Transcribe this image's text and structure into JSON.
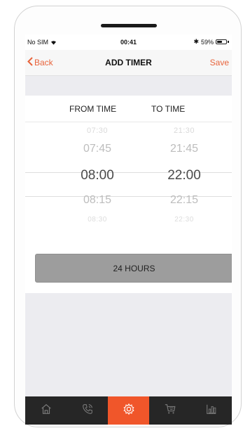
{
  "status_bar": {
    "carrier": "No SIM",
    "wifi_icon": "wifi-icon",
    "time": "00:41",
    "bluetooth": "✱",
    "battery_percent": "59%",
    "battery_level": 0.59
  },
  "nav": {
    "back_label": "Back",
    "title": "ADD TIMER",
    "save_label": "Save"
  },
  "picker": {
    "from_header": "FROM TIME",
    "to_header": "TO TIME",
    "from_values": [
      "07:30",
      "07:45",
      "08:00",
      "08:15",
      "08:30"
    ],
    "to_values": [
      "21:30",
      "21:45",
      "22:00",
      "22:15",
      "22:30"
    ],
    "from_selected": "08:00",
    "to_selected": "22:00"
  },
  "hours_button": {
    "label": "24 HOURS"
  },
  "colors": {
    "accent": "#e8643c",
    "tab_active": "#f0562a",
    "tab_bar": "#262626"
  },
  "tabs": [
    {
      "icon": "home-icon",
      "active": false
    },
    {
      "icon": "phone-icon",
      "active": false
    },
    {
      "icon": "settings-icon",
      "active": true
    },
    {
      "icon": "cart-icon",
      "active": false
    },
    {
      "icon": "chart-icon",
      "active": false
    }
  ]
}
